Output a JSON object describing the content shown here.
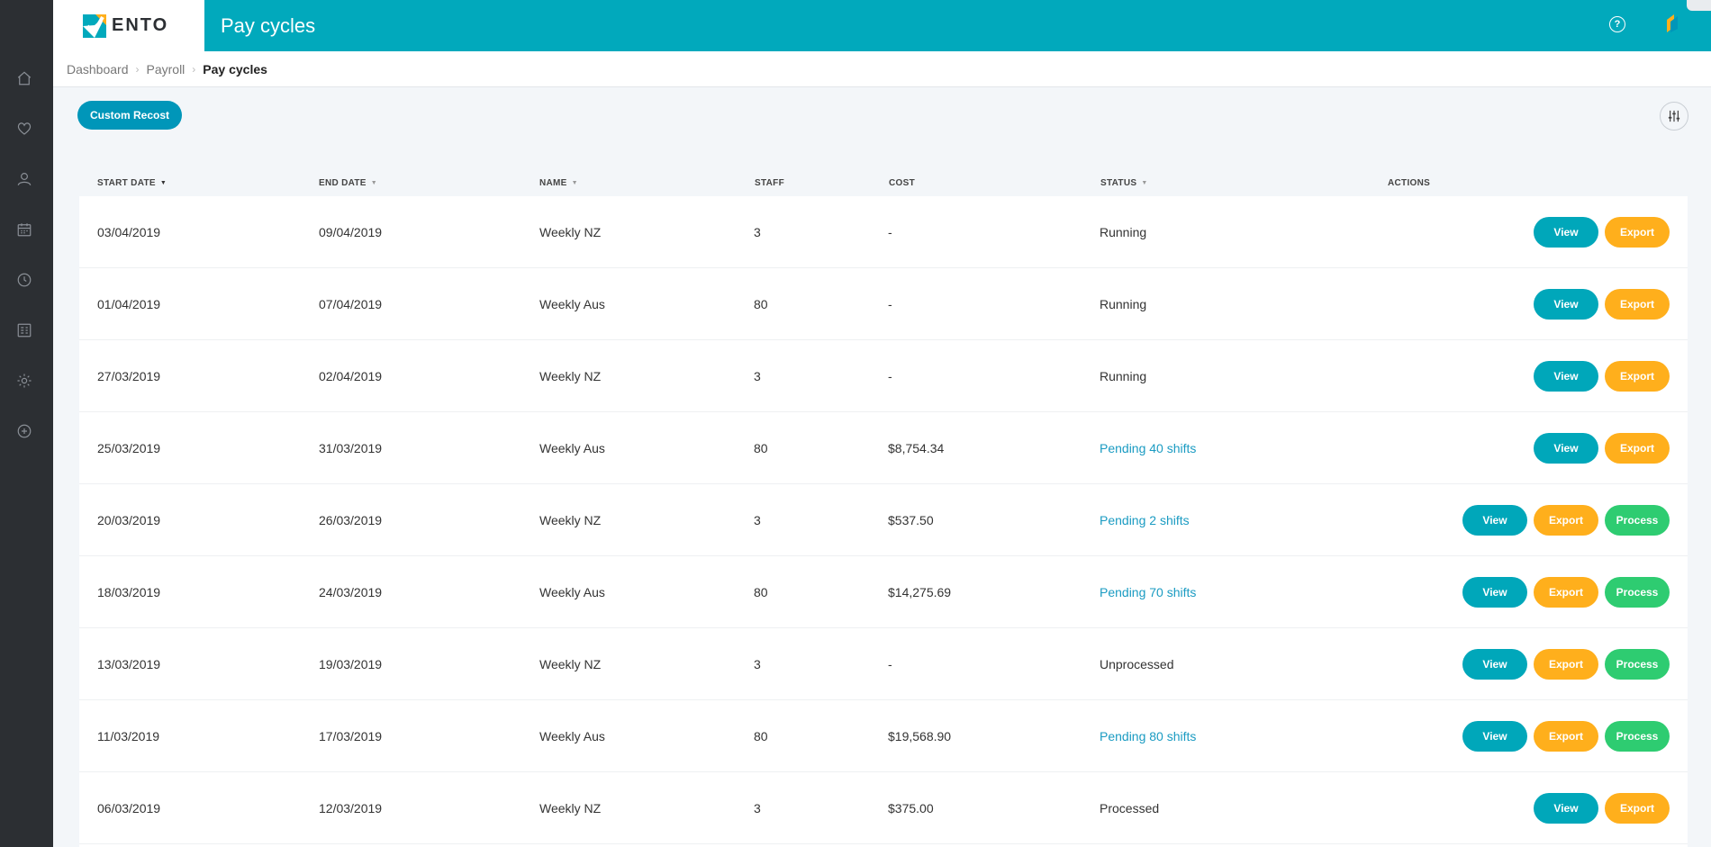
{
  "header": {
    "logo_text": "ENTO",
    "title": "Pay cycles",
    "help_glyph": "?"
  },
  "sidebar": {
    "items": [
      {
        "icon": "home-icon"
      },
      {
        "icon": "heart-icon"
      },
      {
        "icon": "user-icon"
      },
      {
        "icon": "calendar-icon"
      },
      {
        "icon": "clock-icon"
      },
      {
        "icon": "report-icon"
      },
      {
        "icon": "gear-icon"
      },
      {
        "icon": "plus-circle-icon"
      }
    ]
  },
  "breadcrumb": {
    "items": [
      "Dashboard",
      "Payroll",
      "Pay cycles"
    ],
    "separator": "›"
  },
  "toolbar": {
    "custom_recost_label": "Custom Recost"
  },
  "table": {
    "columns": {
      "start_date": "START DATE",
      "end_date": "END DATE",
      "name": "NAME",
      "staff": "STAFF",
      "cost": "COST",
      "status": "STATUS",
      "actions": "ACTIONS"
    },
    "sort_arrow": "▼",
    "button_labels": {
      "view": "View",
      "export": "Export",
      "process": "Process"
    },
    "rows": [
      {
        "start": "03/04/2019",
        "end": "09/04/2019",
        "name": "Weekly NZ",
        "staff": "3",
        "cost": "-",
        "status": "Running",
        "status_link": false,
        "process": false
      },
      {
        "start": "01/04/2019",
        "end": "07/04/2019",
        "name": "Weekly Aus",
        "staff": "80",
        "cost": "-",
        "status": "Running",
        "status_link": false,
        "process": false
      },
      {
        "start": "27/03/2019",
        "end": "02/04/2019",
        "name": "Weekly NZ",
        "staff": "3",
        "cost": "-",
        "status": "Running",
        "status_link": false,
        "process": false
      },
      {
        "start": "25/03/2019",
        "end": "31/03/2019",
        "name": "Weekly Aus",
        "staff": "80",
        "cost": "$8,754.34",
        "status": "Pending 40 shifts",
        "status_link": true,
        "process": false
      },
      {
        "start": "20/03/2019",
        "end": "26/03/2019",
        "name": "Weekly NZ",
        "staff": "3",
        "cost": "$537.50",
        "status": "Pending 2 shifts",
        "status_link": true,
        "process": true
      },
      {
        "start": "18/03/2019",
        "end": "24/03/2019",
        "name": "Weekly Aus",
        "staff": "80",
        "cost": "$14,275.69",
        "status": "Pending 70 shifts",
        "status_link": true,
        "process": true
      },
      {
        "start": "13/03/2019",
        "end": "19/03/2019",
        "name": "Weekly NZ",
        "staff": "3",
        "cost": "-",
        "status": "Unprocessed",
        "status_link": false,
        "process": true
      },
      {
        "start": "11/03/2019",
        "end": "17/03/2019",
        "name": "Weekly Aus",
        "staff": "80",
        "cost": "$19,568.90",
        "status": "Pending 80 shifts",
        "status_link": true,
        "process": true
      },
      {
        "start": "06/03/2019",
        "end": "12/03/2019",
        "name": "Weekly NZ",
        "staff": "3",
        "cost": "$375.00",
        "status": "Processed",
        "status_link": false,
        "process": false
      }
    ]
  },
  "colors": {
    "header_bg": "#01a9bc",
    "sidebar_bg": "#2c2f33",
    "view_btn": "#00a7ba",
    "export_btn": "#ffaf1c",
    "process_btn": "#2ecc71",
    "status_link": "#1a9bc2"
  }
}
